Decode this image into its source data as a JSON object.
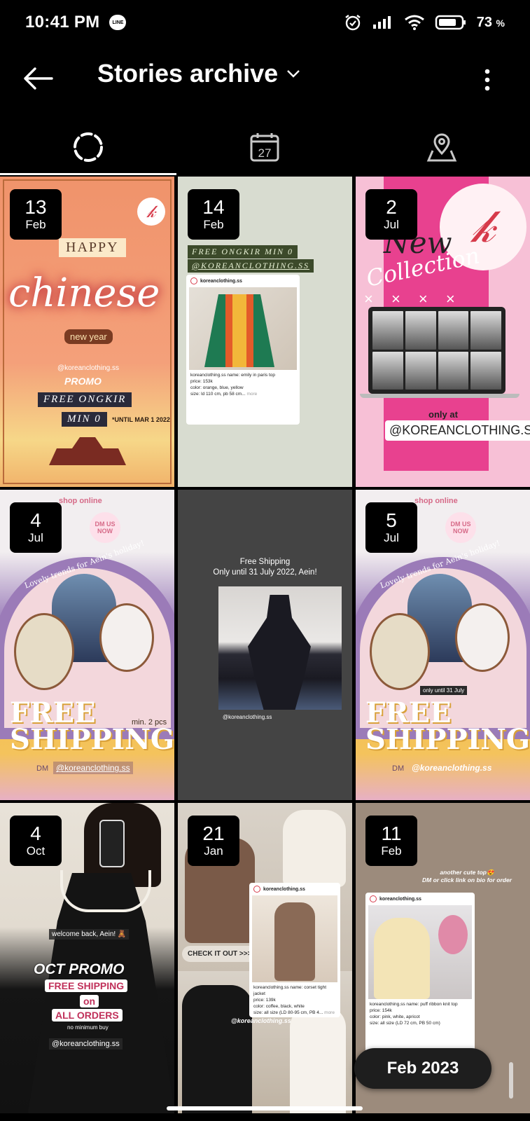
{
  "status_bar": {
    "time": "10:41 PM",
    "notification_app": "LINE",
    "battery_percent": "73",
    "battery_unit": "%"
  },
  "header": {
    "title": "Stories archive"
  },
  "tabs": [
    {
      "name": "stories",
      "icon": "stories-ring-icon",
      "active": true
    },
    {
      "name": "calendar",
      "icon": "calendar-icon",
      "label": "27",
      "active": false
    },
    {
      "name": "map",
      "icon": "map-pin-icon",
      "active": false
    }
  ],
  "stories": [
    {
      "day": "13",
      "month": "Feb",
      "content": {
        "happy": "HAPPY",
        "chinese": "chinese",
        "new_year": "new year",
        "handle": "@koreanclothing.ss",
        "promo": "PROMO",
        "free_ongkir": "FREE ONGKIR",
        "min": "MIN 0",
        "until": "*UNTIL MAR 1 2022"
      }
    },
    {
      "day": "14",
      "month": "Feb",
      "content": {
        "banner1": "FREE ONGKIR MIN 0",
        "banner2": "@KOREANCLOTHING.SS",
        "post_user": "koreanclothing.ss",
        "post_line1": "koreanclothing.ss name: emily in paris top",
        "post_line2": "price: 153k",
        "post_line3": "color: orange, blue, yellow",
        "post_line4": "size: ld 110 cm, pb 58 cm...",
        "post_more": "more"
      }
    },
    {
      "day": "2",
      "month": "Jul",
      "content": {
        "new": "New",
        "collection": "Collection",
        "xs": "× × × ×",
        "only_at": "only at",
        "handle": "@KOREANCLOTHING.SS"
      }
    },
    {
      "day": "4",
      "month": "Jul",
      "content": {
        "shop_online": "shop online",
        "dm_us_now": "DM US NOW",
        "trends": "Lovely trends for Aein's holiday!",
        "free_shipping": "FREE SHIPPING",
        "min": "min. 2 pcs",
        "dm": "DM",
        "handle": "@koreanclothing.ss"
      }
    },
    {
      "content": {
        "caption1": "Free Shipping",
        "caption2": "Only until 31 July 2022, Aein!",
        "handle": "@koreanclothing.ss"
      }
    },
    {
      "day": "5",
      "month": "Jul",
      "content": {
        "shop_online": "shop online",
        "dm_us_now": "DM US NOW",
        "trends": "Lovely trends for Aein's holiday!",
        "only_until": "only until 31 July",
        "free_shipping": "FREE SHIPPING",
        "dm": "DM",
        "handle": "@koreanclothing.ss"
      }
    },
    {
      "day": "4",
      "month": "Oct",
      "content": {
        "welcome": "welcome back, Aein! 🧸",
        "oct_promo": "OCT PROMO",
        "free_shipping": "FREE SHIPPING",
        "on": "on",
        "all_orders": "ALL ORDERS",
        "no_min": "no minimum buy",
        "handle": "@koreanclothing.ss"
      }
    },
    {
      "day": "21",
      "month": "Jan",
      "content": {
        "check_it_out": "CHECK IT OUT >>>",
        "post_user": "koreanclothing.ss",
        "post_line1": "koreanclothing.ss name: corset tight jacket",
        "post_line2": "price: 139k",
        "post_line3": "color: coffee, black, white",
        "post_line4": "size: all size (LD 80-95 cm, PB 4...",
        "post_more": "more",
        "handle": "@koreanclothing.ss"
      }
    },
    {
      "day": "11",
      "month": "Feb",
      "content": {
        "caption1": "another cute top😍",
        "caption2": "DM or click link on bio for order",
        "post_user": "koreanclothing.ss",
        "post_line1": "koreanclothing.ss name: puff ribbon knit top",
        "post_line2": "price: 154k",
        "post_line3": "color: pink, white, apricot",
        "post_line4": "size: all size (LD 72 cm, PB 50 cm)"
      }
    }
  ],
  "date_scrubber": "Feb 2023"
}
